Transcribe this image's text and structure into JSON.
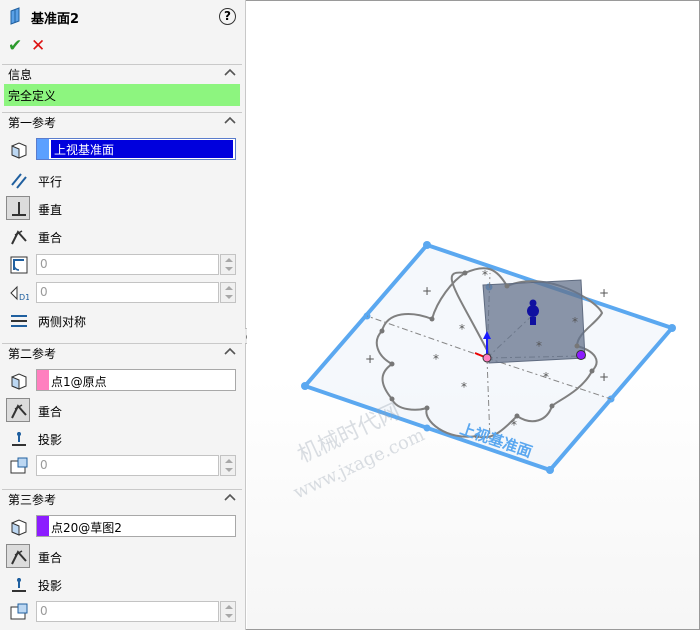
{
  "feature": {
    "title": "基准面2",
    "help_label": "?",
    "ok_label": "✔",
    "cancel_label": "✕"
  },
  "info": {
    "section_label": "信息",
    "status": "完全定义",
    "status_color": "#8df57f"
  },
  "first_ref": {
    "section_label": "第一参考",
    "selection": "上视基准面",
    "selection_color": "#5ba0ff",
    "options": [
      "平行",
      "垂直",
      "重合"
    ],
    "angle_value": "0",
    "offset_value": "0",
    "symmetric_label": "两侧对称"
  },
  "second_ref": {
    "section_label": "第二参考",
    "selection": "点1@原点",
    "selection_color": "#ff7fbf",
    "options": [
      "重合",
      "投影"
    ],
    "value": "0"
  },
  "third_ref": {
    "section_label": "第三参考",
    "selection": "点20@草图2",
    "selection_color": "#8c1cff",
    "options": [
      "重合",
      "投影"
    ],
    "value": "0"
  },
  "viewport": {
    "plane_label": "上视基准面",
    "watermark_1": "机械时代网",
    "watermark_2": "www.jxage.com",
    "plane_color": "#5ba8f0"
  }
}
